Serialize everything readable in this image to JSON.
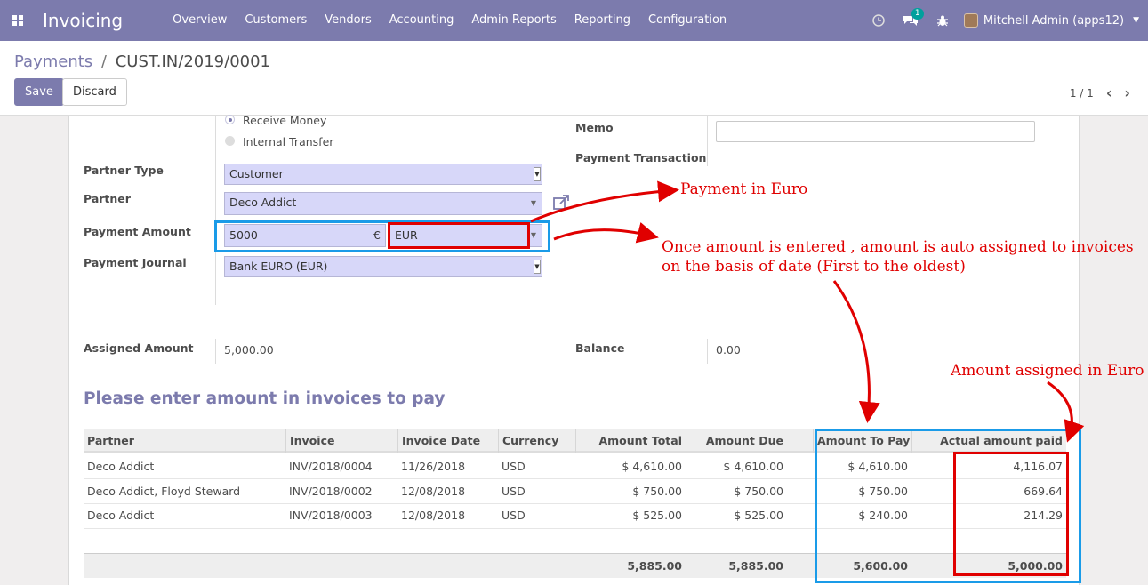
{
  "navbar": {
    "brand": "Invoicing",
    "menu": [
      "Overview",
      "Customers",
      "Vendors",
      "Accounting",
      "Admin Reports",
      "Reporting",
      "Configuration"
    ],
    "messages_badge": "1",
    "user": "Mitchell Admin (apps12)"
  },
  "control": {
    "breadcrumb_parent": "Payments",
    "breadcrumb_sep": "/",
    "breadcrumb_current": "CUST.IN/2019/0001",
    "save_label": "Save",
    "discard_label": "Discard",
    "pager": "1 / 1"
  },
  "form": {
    "radio_receive": "Receive Money",
    "radio_internal": "Internal Transfer",
    "partner_type_label": "Partner Type",
    "partner_type_value": "Customer",
    "partner_label": "Partner",
    "partner_value": "Deco Addict",
    "payment_amount_label": "Payment Amount",
    "payment_amount_value": "5000",
    "currency_symbol": "€",
    "currency_value": "EUR",
    "payment_journal_label": "Payment Journal",
    "payment_journal_value": "Bank EURO (EUR)",
    "memo_label": "Memo",
    "payment_transaction_label": "Payment Transaction",
    "assigned_amount_label": "Assigned Amount",
    "assigned_amount_value": "5,000.00",
    "balance_label": "Balance",
    "balance_value": "0.00"
  },
  "section_title": "Please enter amount in invoices to pay",
  "table": {
    "headers": [
      "Partner",
      "Invoice",
      "Invoice Date",
      "Currency",
      "Amount Total",
      "Amount Due",
      "Amount To Pay",
      "Actual amount paid"
    ],
    "rows": [
      [
        "Deco Addict",
        "INV/2018/0004",
        "11/26/2018",
        "USD",
        "$ 4,610.00",
        "$ 4,610.00",
        "$ 4,610.00",
        "4,116.07"
      ],
      [
        "Deco Addict, Floyd Steward",
        "INV/2018/0002",
        "12/08/2018",
        "USD",
        "$ 750.00",
        "$ 750.00",
        "$ 750.00",
        "669.64"
      ],
      [
        "Deco Addict",
        "INV/2018/0003",
        "12/08/2018",
        "USD",
        "$ 525.00",
        "$ 525.00",
        "$ 240.00",
        "214.29"
      ]
    ],
    "totals": {
      "amount_total": "5,885.00",
      "amount_due": "5,885.00",
      "amount_to_pay": "5,600.00",
      "actual_paid": "5,000.00"
    }
  },
  "annotations": {
    "payment_in_euro": "Payment in Euro",
    "auto_assign_line1": "Once amount is entered , amount is auto assigned to invoices",
    "auto_assign_line2": "on the basis of date (First to the oldest)",
    "amount_assigned": "Amount assigned  in Euro",
    "red": "#e00000",
    "blue": "#1a9be8"
  },
  "colors": {
    "brand": "#7c7bad",
    "field_bg": "#d7d7f9"
  }
}
